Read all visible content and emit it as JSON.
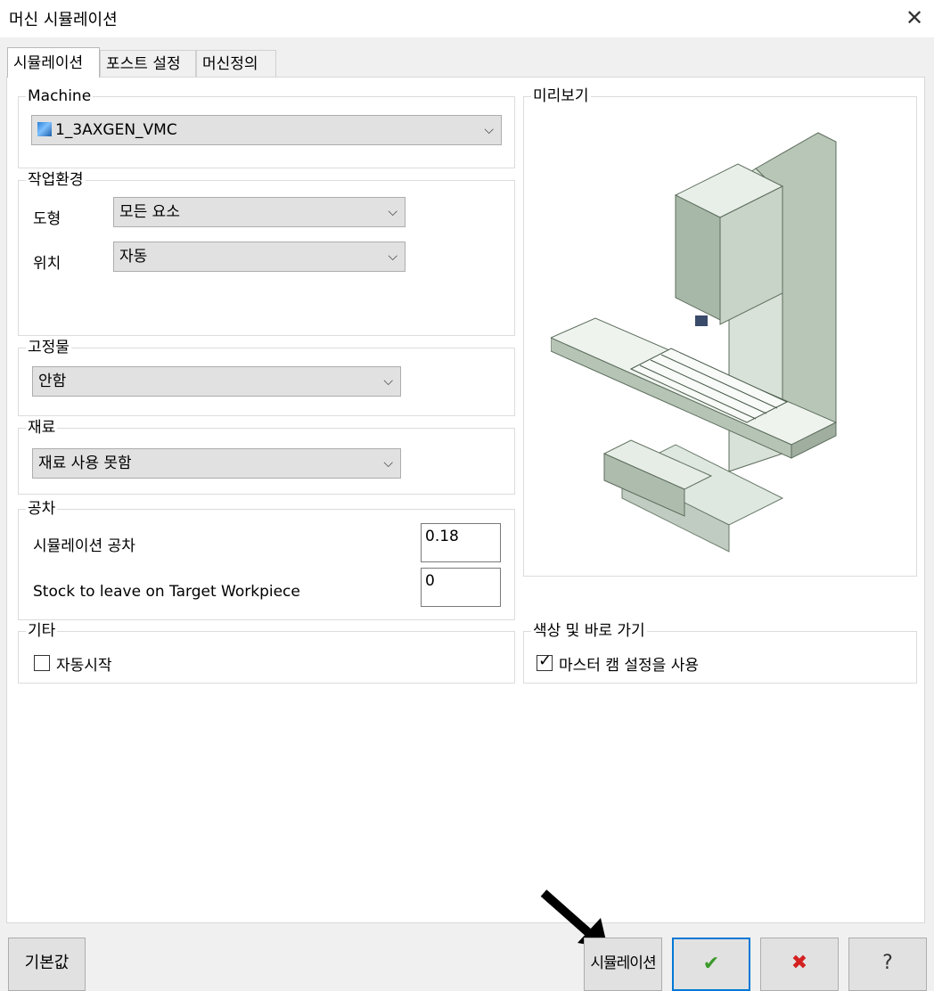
{
  "window": {
    "title": "머신 시뮬레이션",
    "close_label": "✕"
  },
  "tabs": [
    {
      "label": "시뮬레이션",
      "active": true
    },
    {
      "label": "포스트 설정",
      "active": false
    },
    {
      "label": "머신정의",
      "active": false
    }
  ],
  "machine": {
    "legend": "Machine",
    "selected": "1_3AXGEN_VMC",
    "icon": "machine-icon"
  },
  "workenv": {
    "legend": "작업환경",
    "geometry_label": "도형",
    "geometry_value": "모든 요소",
    "position_label": "위치",
    "position_value": "자동"
  },
  "fixture": {
    "legend": "고정물",
    "value": "안함"
  },
  "material": {
    "legend": "재료",
    "value": "재료 사용 못함"
  },
  "tolerance": {
    "legend": "공차",
    "sim_label": "시뮬레이션 공차",
    "sim_value": "0.18",
    "stock_label": "Stock to leave on Target Workpiece",
    "stock_value": "0"
  },
  "other": {
    "legend": "기타",
    "autostart_label": "자동시작",
    "autostart_checked": false
  },
  "preview": {
    "legend": "미리보기"
  },
  "colors": {
    "legend": "색상 및 바로 가기",
    "use_master_label": "마스터 캠 설정을 사용",
    "use_master_checked": true
  },
  "footer": {
    "defaults_label": "기본값",
    "simulate_label": "시뮬레이션",
    "ok_glyph": "✔",
    "cancel_glyph": "✖",
    "help_glyph": "?"
  },
  "accent": {
    "ok_green": "#3a9a2a",
    "cancel_red": "#d42020",
    "focus_blue": "#0078d7"
  }
}
